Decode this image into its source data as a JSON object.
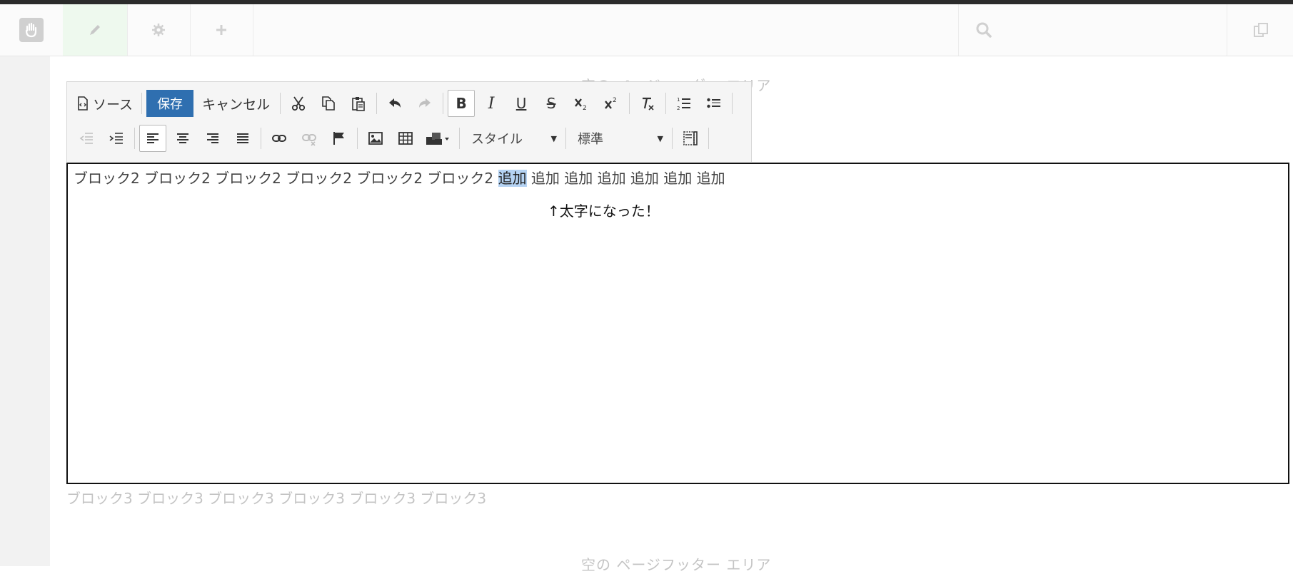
{
  "cms_bar": {
    "icons": [
      "hand-logo-icon",
      "pencil-icon",
      "gear-icon",
      "plus-icon",
      "search-icon",
      "copy-pages-icon"
    ]
  },
  "page": {
    "header_area": "空の ページヘッダー エリア",
    "footer_area": "空の ページフッター エリア",
    "block2_text": "ブロック2 ブロック2 ブロック2 ブロック2 ブロック2 ブロック2",
    "block2_selected": "追加",
    "block2_rest": "追加 追加 追加 追加 追加 追加",
    "note": "↑太字になった！",
    "block3_text": "ブロック3 ブロック3 ブロック3 ブロック3 ブロック3 ブロック3"
  },
  "toolbar": {
    "source_label": "ソース",
    "save_label": "保存",
    "cancel_label": "キャンセル",
    "bold_glyph": "B",
    "italic_glyph": "I",
    "underline_glyph": "U",
    "strike_glyph": "S",
    "styles_label": "スタイル",
    "format_label": "標準"
  },
  "colors": {
    "save_button": "#2f6fb0",
    "selection_highlight": "#b5d3f3",
    "edit_mode_tint": "#eef9ee"
  }
}
